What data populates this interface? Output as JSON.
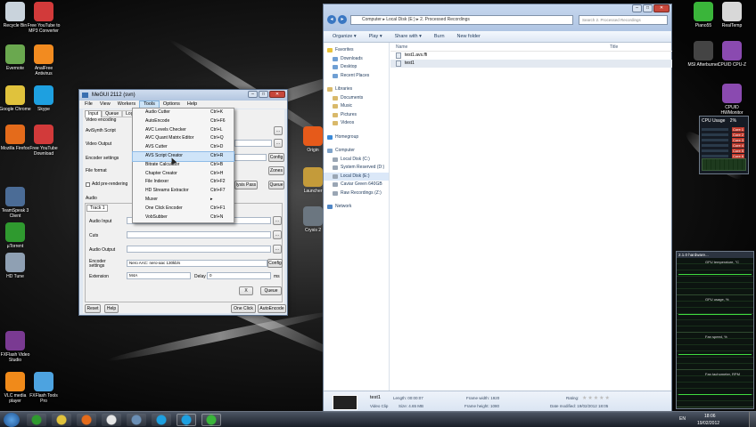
{
  "desktop": {
    "left_icons": [
      {
        "label": "Recycle Bin",
        "color": "#c9d3dc"
      },
      {
        "label": "Free YouTube to MP3 Converter",
        "color": "#d23a3a"
      },
      {
        "label": "Evernote",
        "color": "#6aa84f"
      },
      {
        "label": "AnalFree Antivirus",
        "color": "#f28b20"
      },
      {
        "label": "Google Chrome",
        "color": "#e0c23c"
      },
      {
        "label": "Skype",
        "color": "#1ea0e0"
      },
      {
        "label": "Mozilla Firefox",
        "color": "#e46b1b"
      },
      {
        "label": "Free YouTube Download",
        "color": "#d23a3a"
      },
      {
        "label": "TeamSpeak 3 Client",
        "color": "#4b6c96"
      },
      {
        "label": "µTorrent",
        "color": "#2f9a2f"
      },
      {
        "label": "HD Tune",
        "color": "#8fa0b3"
      },
      {
        "label": "FXFlash Video Studio",
        "color": "#7a3a92"
      },
      {
        "label": "VLC media player",
        "color": "#f08a1a"
      },
      {
        "label": "FXFlash Tools Pro",
        "color": "#4da3e0"
      }
    ],
    "mid_icons": [
      {
        "label": "Origin",
        "color": "#e65a1a"
      },
      {
        "label": "Launcher",
        "color": "#c49b3a"
      },
      {
        "label": "Crysis 2",
        "color": "#6b7680"
      }
    ],
    "right_icons": [
      {
        "label": "Piano55",
        "color": "#3ab53a"
      },
      {
        "label": "RealTemp",
        "color": "#d8d8d8"
      },
      {
        "label": "MSI Afterburner",
        "color": "#444"
      },
      {
        "label": "CPUID CPU-Z",
        "color": "#8a4ab0"
      },
      {
        "label": "CPUID HWMonitor",
        "color": "#8a4ab0"
      }
    ]
  },
  "megui": {
    "title": "MeGUI 2112 (svn)",
    "menus": [
      "File",
      "View",
      "Workers",
      "Tools",
      "Options",
      "Help"
    ],
    "tabs": [
      "Input",
      "Queue",
      "Log"
    ],
    "video_encoding_label": "Video encoding",
    "avisynth_label": "AviSynth Script",
    "video_output_label": "Video Output",
    "encoder_settings_label": "Encoder settings",
    "file_format_label": "File format",
    "add_prerendering_label": "Add pre-rendering",
    "audio_label": "Audio",
    "track_tab": "Track 1",
    "audio_input_label": "Audio Input",
    "cuts_label": "Cuts",
    "audio_output_label": "Audio Output",
    "audio_encoder_label": "Encoder settings",
    "audio_encoder_value": "Nero AAC: nero-aac 130kb/s",
    "extension_label": "Extension",
    "extension_value": "M4A",
    "delay_label": "Delay",
    "delay_value": "0",
    "ms_label": "ms",
    "config_btn": "Config",
    "zones_btn": "Zones",
    "analysis_pass_btn": "lysis Pass",
    "queue_btn": "Queue",
    "x_btn": "X",
    "reset_btn": "Reset",
    "help_btn": "Help",
    "one_click_btn": "One Click",
    "autoencode_btn": "AutoEncode",
    "browse_label": "...",
    "tools_menu": [
      {
        "label": "Audio Cutter",
        "shortcut": "Ctrl+K"
      },
      {
        "label": "AutoEncode",
        "shortcut": "Ctrl+F6"
      },
      {
        "label": "AVC Levels Checker",
        "shortcut": "Ctrl+L"
      },
      {
        "label": "AVC Quant Matrix Editor",
        "shortcut": "Ctrl+Q"
      },
      {
        "label": "AVS Cutter",
        "shortcut": "Ctrl+D"
      },
      {
        "label": "AVS Script Creator",
        "shortcut": "Ctrl+R"
      },
      {
        "label": "Bitrate Calculator",
        "shortcut": "Ctrl+B"
      },
      {
        "label": "Chapter Creator",
        "shortcut": "Ctrl+H"
      },
      {
        "label": "File Indexer",
        "shortcut": "Ctrl+F2"
      },
      {
        "label": "HD Streams Extractor",
        "shortcut": "Ctrl+F7"
      },
      {
        "label": "Muxer",
        "shortcut": "▸"
      },
      {
        "label": "One Click Encoder",
        "shortcut": "Ctrl+F1"
      },
      {
        "label": "VobSubber",
        "shortcut": "Ctrl+N"
      }
    ],
    "highlighted_index": 5
  },
  "explorer": {
    "breadcrumb": [
      "Computer",
      "Local Disk (E:)",
      "2. Processed Recordings"
    ],
    "search_placeholder": "Search 2. Processed Recordings",
    "commands": [
      "Organize ▾",
      "Play ▾",
      "Share with ▾",
      "Burn",
      "New folder"
    ],
    "nav": {
      "favorites_header": "Favorites",
      "favorites": [
        "Downloads",
        "Desktop",
        "Recent Places"
      ],
      "libraries_header": "Libraries",
      "libraries": [
        "Documents",
        "Music",
        "Pictures",
        "Videos"
      ],
      "homegroup": "Homegroup",
      "computer_header": "Computer",
      "drives": [
        "Local Disk (C:)",
        "System Reserved (D:)",
        "Local Disk (E:)",
        "Caviar Green 640GB",
        "Raw Recordings (Z:)"
      ],
      "network": "Network"
    },
    "columns": [
      "Name",
      "Title"
    ],
    "files": [
      "test1.avs.ffi",
      "test1"
    ],
    "details": {
      "name": "test1",
      "type": "Video Clip",
      "length": "Length: 00:00:07",
      "size": "Size: 4.65 MB",
      "frame_width": "Frame width: 1920",
      "frame_height": "Frame height: 1080",
      "rating": "Rating:",
      "date_modified": "Date modified: 19/02/2012 18:05"
    }
  },
  "gadgets": {
    "cpu_title": "CPU Usage",
    "cpu_percent": "2%",
    "cores": [
      "Core 1",
      "Core 2",
      "Core 3",
      "Core 4",
      "Core 5",
      "Core 6"
    ],
    "hw_title": "2.1.0 hardware...",
    "hw_labels": [
      "GPU temperature, °C",
      "GPU usage, %",
      "Fan speed, %",
      "Fan tachometer, RPM"
    ]
  },
  "taskbar": {
    "lang": "EN",
    "time": "18:06",
    "date": "19/02/2012",
    "pinned_colors": [
      "#2f9a2f",
      "#e0c23c",
      "#e46b1b",
      "#e6e6e6",
      "#6b8fb5",
      "#1ea0e0",
      "#1ea0e0",
      "#3ab53a"
    ]
  }
}
